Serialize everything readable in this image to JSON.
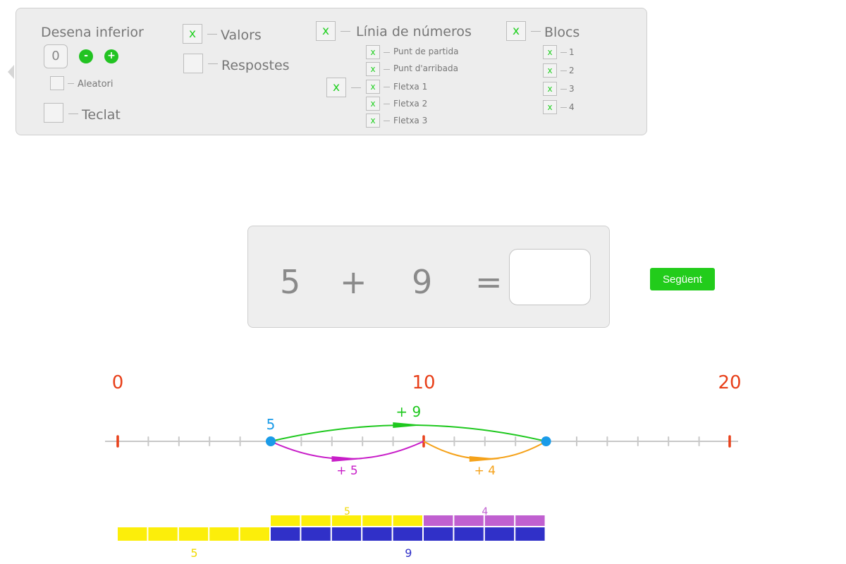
{
  "settings": {
    "desena_inferior_label": "Desena inferior",
    "counter_value": "0",
    "minus_symbol": "-",
    "plus_symbol": "+",
    "aleatori_label": "Aleatori",
    "teclat_label": "Teclat",
    "valors_label": "Valors",
    "valors_checked": "x",
    "respostes_label": "Respostes",
    "linia_label": "Línia de números",
    "linia_checked": "x",
    "punt_partida_label": "Punt de partida",
    "punt_partida_checked": "x",
    "punt_arribada_label": "Punt d'arribada",
    "punt_arribada_checked": "x",
    "fletxes_checked": "x",
    "fletxa1_label": "Fletxa 1",
    "fletxa1_checked": "x",
    "fletxa2_label": "Fletxa 2",
    "fletxa2_checked": "x",
    "fletxa3_label": "Fletxa 3",
    "fletxa3_checked": "x",
    "blocs_label": "Blocs",
    "blocs_checked": "x",
    "bloc_items": [
      {
        "label": "1",
        "checked": "x"
      },
      {
        "label": "2",
        "checked": "x"
      },
      {
        "label": "3",
        "checked": "x"
      },
      {
        "label": "4",
        "checked": "x"
      }
    ]
  },
  "equation": {
    "a": "5",
    "op": "+",
    "b": "9",
    "eq": "=",
    "answer": ""
  },
  "next_button": "Següent",
  "number_line": {
    "min": 0,
    "max": 20,
    "labels": [
      "0",
      "10",
      "20"
    ],
    "start_label": "5",
    "jump_total": "+ 9",
    "jump1": "+ 5",
    "jump2": "+ 4",
    "colors": {
      "axis": "#c8c8c8",
      "endpoints": "#e8401a",
      "points": "#1a9be8",
      "total": "#1ec81e",
      "jump1": "#c81ec8",
      "jump2": "#f5a21a"
    }
  },
  "blocks": {
    "bottom_left_label": "5",
    "bottom_label": "9",
    "top_left_label": "5",
    "top_right_label": "4",
    "colors": {
      "yellow": "#fcee0a",
      "blue": "#3030c8",
      "purple": "#c060d0"
    }
  }
}
